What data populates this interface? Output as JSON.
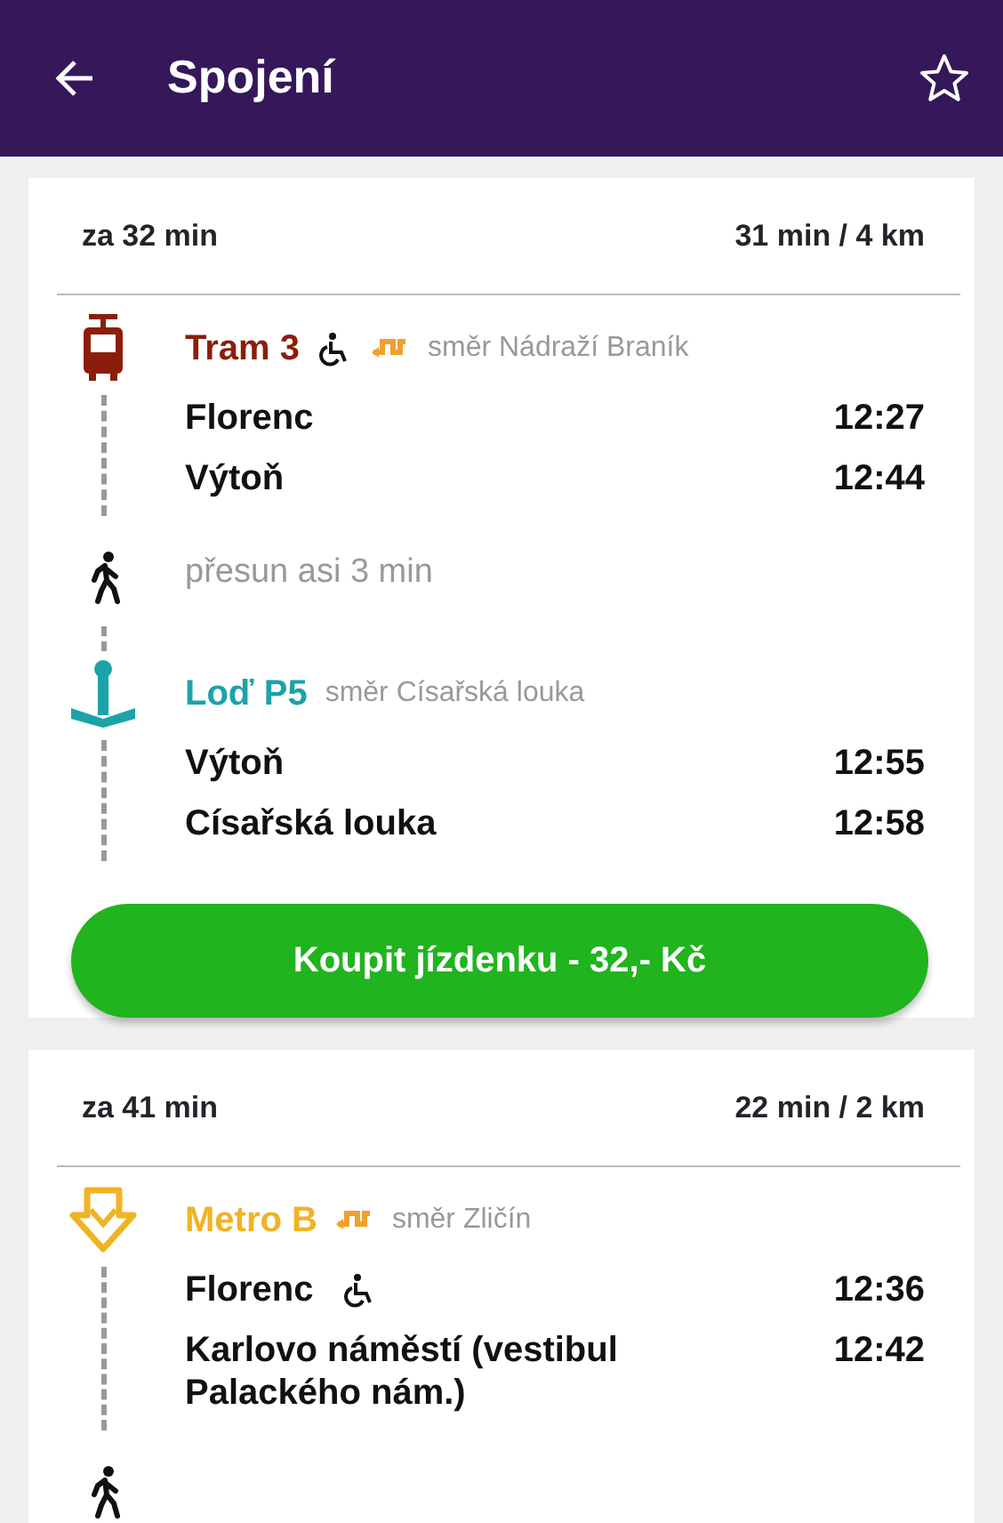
{
  "app_bar": {
    "title": "Spojení",
    "favorite": false
  },
  "connections": [
    {
      "departs_in": "za 32 min",
      "duration": "31 min / 4 km",
      "segments": [
        {
          "kind": "tram",
          "line": "Tram 3",
          "color": "#8b1e0a",
          "accessible": true,
          "transfer": true,
          "direction": "směr Nádraží Braník",
          "stops": [
            {
              "name": "Florenc",
              "time": "12:27",
              "accessible": false
            },
            {
              "name": "Výtoň",
              "time": "12:44",
              "accessible": false
            }
          ]
        },
        {
          "kind": "walk",
          "text": "přesun asi 3 min"
        },
        {
          "kind": "boat",
          "line": "Loď P5",
          "color": "#1ba3a8",
          "accessible": false,
          "transfer": false,
          "direction": "směr Císařská louka",
          "stops": [
            {
              "name": "Výtoň",
              "time": "12:55",
              "accessible": false
            },
            {
              "name": "Císařská louka",
              "time": "12:58",
              "accessible": false
            }
          ]
        }
      ],
      "buy_button": "Koupit jízdenku - 32,- Kč"
    },
    {
      "departs_in": "za 41 min",
      "duration": "22 min / 2 km",
      "segments": [
        {
          "kind": "metro",
          "line": "Metro B",
          "color": "#f0b323",
          "accessible": false,
          "transfer": true,
          "direction": "směr Zličín",
          "stops": [
            {
              "name": "Florenc",
              "time": "12:36",
              "accessible": true
            },
            {
              "name": "Karlovo náměstí (vestibul Palackého nám.)",
              "time": "12:42",
              "accessible": false
            }
          ]
        },
        {
          "kind": "walk"
        }
      ]
    }
  ]
}
